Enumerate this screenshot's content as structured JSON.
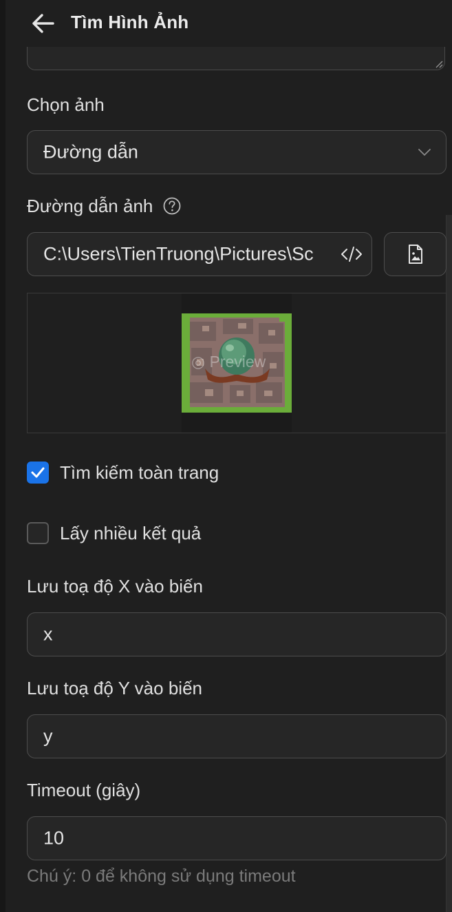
{
  "header": {
    "back_icon": "arrow-left-icon",
    "title": "Tìm Hình Ảnh"
  },
  "image_select": {
    "label": "Chọn ảnh",
    "value": "Đường dẫn",
    "chevron_icon": "chevron-down-icon"
  },
  "image_path": {
    "label": "Đường dẫn ảnh",
    "help_icon": "question-circle-icon",
    "value": "C:\\Users\\TienTruong\\Pictures\\Sc",
    "code_icon": "code-icon",
    "file_icon": "image-file-icon"
  },
  "preview": {
    "watermark": "Preview"
  },
  "options": {
    "search_whole_page": {
      "label": "Tìm kiếm toàn trang",
      "checked": true
    },
    "multiple_results": {
      "label": "Lấy nhiều kết quả",
      "checked": false
    }
  },
  "save_x": {
    "label": "Lưu toạ độ X vào biến",
    "value": "x"
  },
  "save_y": {
    "label": "Lưu toạ độ Y vào biến",
    "value": "y"
  },
  "timeout": {
    "label": "Timeout (giây)",
    "value": "10",
    "hint": "Chú ý: 0 để không sử dụng timeout"
  },
  "colors": {
    "background": "#1f1f1f",
    "field": "#262626",
    "border": "#4d4d4d",
    "accent": "#1a73e8",
    "hint": "#7b7b7b"
  }
}
